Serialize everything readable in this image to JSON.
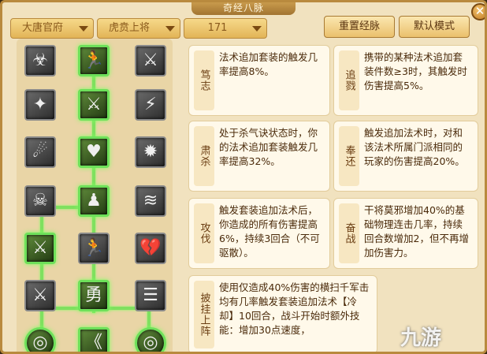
{
  "window": {
    "title": "奇经八脉",
    "close_glyph": "✕"
  },
  "filters": {
    "sect": "大唐官府",
    "rank": "虎贲上将",
    "level": "171"
  },
  "buttons": {
    "reset": "重置经脉",
    "default": "默认模式"
  },
  "tree_icons": [
    {
      "glyph": "☣"
    },
    {
      "glyph": "🏃"
    },
    {
      "glyph": "⚔"
    },
    {
      "glyph": "✦"
    },
    {
      "glyph": "⚔"
    },
    {
      "glyph": "⚡"
    },
    {
      "glyph": "☄"
    },
    {
      "glyph": "♥"
    },
    {
      "glyph": "✹"
    },
    {
      "glyph": "☠"
    },
    {
      "glyph": "♟"
    },
    {
      "glyph": "≋"
    },
    {
      "glyph": "⚔"
    },
    {
      "glyph": "🏃"
    },
    {
      "glyph": "💔"
    },
    {
      "glyph": "⚔"
    },
    {
      "glyph": "勇"
    },
    {
      "glyph": "☰"
    },
    {
      "glyph": "◎"
    },
    {
      "glyph": "《"
    },
    {
      "glyph": "◎"
    }
  ],
  "skills": [
    {
      "name": "笃志",
      "desc": "法术追加套装的触发几率提高8%。"
    },
    {
      "name": "追戮",
      "desc": "携带的某种法术追加套装件数≥3时，其触发时伤害提高5%。"
    },
    {
      "name": "肃杀",
      "desc": "处于杀气诀状态时，你的法术追加套装触发几率提高32%。"
    },
    {
      "name": "奉还",
      "desc": "触发追加法术时，对和该法术所属门派相同的玩家的伤害提高20%。"
    },
    {
      "name": "攻伐",
      "desc": "触发套装追加法术后，你造成的所有伤害提高6%，持续3回合（不可驱散）。"
    },
    {
      "name": "奋战",
      "desc": "干将莫邪增加40%的基础物理连击几率，持续回合数增加2，但不再增加伤害力。"
    },
    {
      "name": "披挂上阵",
      "desc": "使用仅造成40%伤害的横扫千军击均有几率触发套装追加法术【冷却】10回合，战斗开始时额外技能：增加30点速度，"
    }
  ],
  "watermark": "九游"
}
